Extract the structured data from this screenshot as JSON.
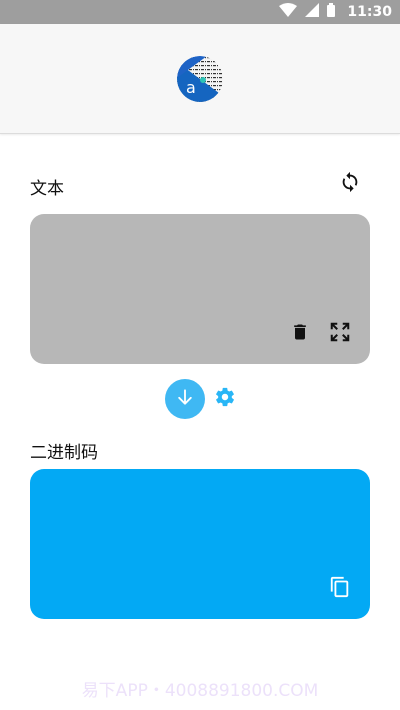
{
  "status_bar": {
    "time": "11:30",
    "icons": [
      "wifi-icon",
      "signal-icon",
      "battery-icon"
    ]
  },
  "header": {
    "logo_icon": "app-logo"
  },
  "text_section": {
    "title": "文本",
    "value": "",
    "refresh_icon": "refresh-icon",
    "delete_icon": "trash-icon",
    "fullscreen_icon": "fullscreen-icon"
  },
  "actions": {
    "convert_icon": "arrow-down-icon",
    "settings_icon": "gear-icon"
  },
  "binary_section": {
    "title": "二进制码",
    "value": "",
    "copy_icon": "copy-icon"
  },
  "watermark": "易下APP・4008891800.COM",
  "colors": {
    "status_bar": "#9e9e9e",
    "text_panel": "#b7b7b7",
    "binary_panel": "#03a9f4",
    "convert_button": "#3fb8f3",
    "settings_icon": "#29b6f6"
  }
}
